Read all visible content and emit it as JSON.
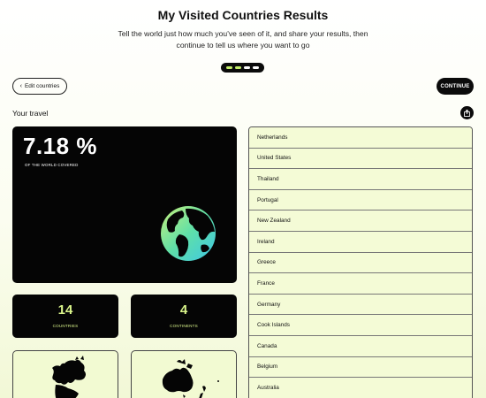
{
  "header": {
    "title": "My Visited Countries Results",
    "subtitle": "Tell the world just how much you've seen of it, and share your results, then continue to tell us where you want to go"
  },
  "stepper": {
    "steps": 4,
    "active": 2
  },
  "toolbar": {
    "edit_label": "Edit countries",
    "continue_label": "CONTINUE"
  },
  "section": {
    "label": "Your travel"
  },
  "summary": {
    "percent": "7.18 %",
    "percent_label": "OF THE WORLD COVERED"
  },
  "stats": {
    "countries_value": "14",
    "countries_label": "COUNTRIES",
    "continents_value": "4",
    "continents_label": "CONTINENTS"
  },
  "countries": [
    "Netherlands",
    "United States",
    "Thailand",
    "Portugal",
    "New Zealand",
    "Ireland",
    "Greece",
    "France",
    "Germany",
    "Cook Islands",
    "Canada",
    "Belgium",
    "Australia"
  ],
  "colors": {
    "accent": "#d9f48a",
    "stepper_active": "#c4ef6b",
    "card_bg": "#050505",
    "list_bg": "#f4fbd6"
  },
  "icons": {
    "edit": "chevron-left-icon",
    "share": "share-icon",
    "globe": "globe-icon"
  }
}
